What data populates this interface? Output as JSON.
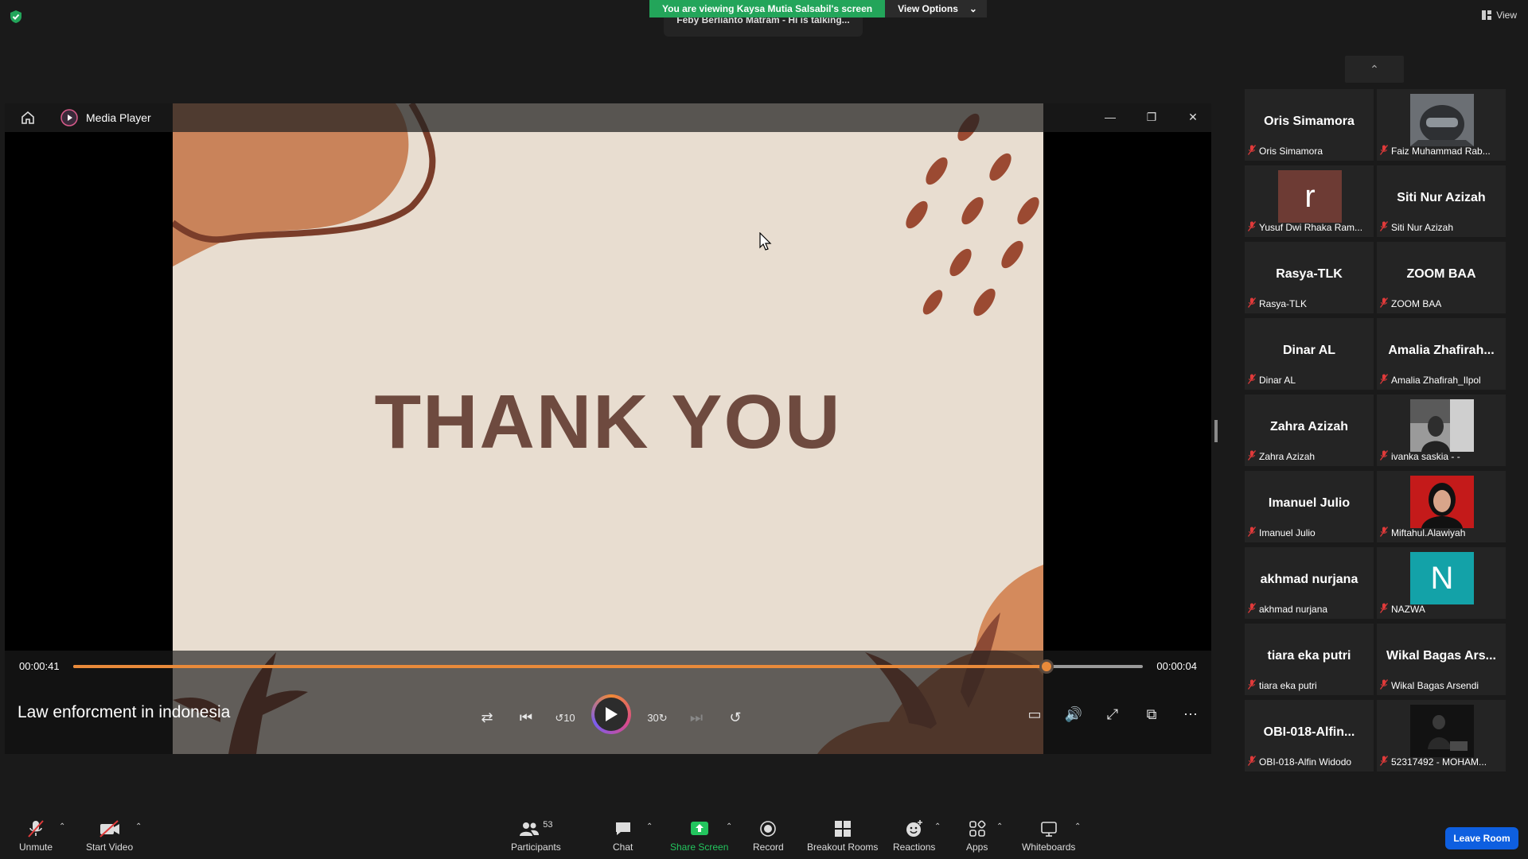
{
  "banner": {
    "viewing_text": "You are viewing Kaysa Mutia Salsabil's screen",
    "view_options_label": "View Options",
    "talking_text": "Feby Berlianto Matram - Hi is talking..."
  },
  "top_right": {
    "view_label": "View"
  },
  "media_player": {
    "app_title": "Media Player",
    "slide_title": "THANK YOU",
    "time_elapsed": "00:00:41",
    "time_remaining": "00:00:04",
    "progress": 0.91,
    "video_title": "Law enforcment in indonesia",
    "colors": {
      "accent": "#e98a3a",
      "slide_bg": "#e8ddd0",
      "slide_text": "#6e4a3f"
    }
  },
  "participants": [
    {
      "display": "Oris Simamora",
      "label": "Oris Simamora",
      "kind": "name"
    },
    {
      "display": "",
      "label": "Faiz Muhammad Rab...",
      "kind": "photo-helmet"
    },
    {
      "display": "r",
      "label": "Yusuf Dwi Rhaka Ram...",
      "kind": "letter",
      "color": "#6d3b34"
    },
    {
      "display": "Siti Nur Azizah",
      "label": "Siti Nur Azizah",
      "kind": "name"
    },
    {
      "display": "Rasya-TLK",
      "label": "Rasya-TLK",
      "kind": "name"
    },
    {
      "display": "ZOOM BAA",
      "label": "ZOOM BAA",
      "kind": "name"
    },
    {
      "display": "Dinar AL",
      "label": "Dinar AL",
      "kind": "name"
    },
    {
      "display": "Amalia  Zhafirah...",
      "label": "Amalia Zhafirah_Ilpol",
      "kind": "name"
    },
    {
      "display": "Zahra Azizah",
      "label": "Zahra Azizah",
      "kind": "name"
    },
    {
      "display": "",
      "label": "ivanka saskia - -",
      "kind": "photo-bw"
    },
    {
      "display": "Imanuel Julio",
      "label": "Imanuel Julio",
      "kind": "name"
    },
    {
      "display": "",
      "label": "Miftahul.Alawiyah",
      "kind": "photo-red"
    },
    {
      "display": "akhmad nurjana",
      "label": "akhmad nurjana",
      "kind": "name"
    },
    {
      "display": "N",
      "label": "NAZWA",
      "kind": "letter",
      "color": "#13a2a8"
    },
    {
      "display": "tiara eka putri",
      "label": "tiara eka putri",
      "kind": "name"
    },
    {
      "display": "Wikal  Bagas  Ars...",
      "label": "Wikal Bagas Arsendi",
      "kind": "name"
    },
    {
      "display": "OBI-018-Alfin...",
      "label": "OBI-018-Alfin Widodo",
      "kind": "name"
    },
    {
      "display": "",
      "label": "52317492 - MOHAM...",
      "kind": "photo-dark"
    }
  ],
  "toolbar": {
    "unmute": "Unmute",
    "start_video": "Start Video",
    "participants": "Participants",
    "participants_count": "53",
    "chat": "Chat",
    "share_screen": "Share Screen",
    "record": "Record",
    "breakout_rooms": "Breakout Rooms",
    "reactions": "Reactions",
    "apps": "Apps",
    "whiteboards": "Whiteboards",
    "leave": "Leave Room",
    "share_color": "#23c55e",
    "leave_color": "#0e5fe0"
  }
}
